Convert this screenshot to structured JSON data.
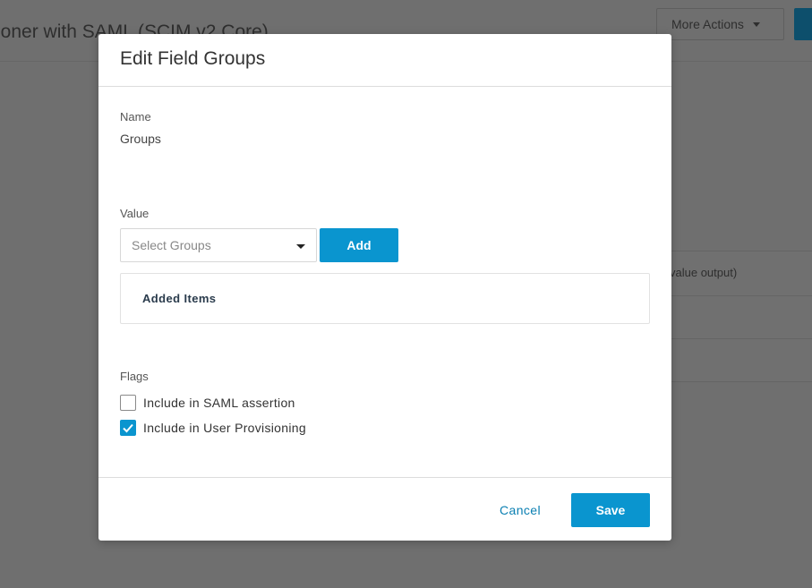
{
  "background": {
    "page_title": "ioner with SAML (SCIM v2 Core)",
    "more_actions_label": "More Actions",
    "table_text": "value output)"
  },
  "modal": {
    "title": "Edit Field Groups",
    "name_label": "Name",
    "name_value": "Groups",
    "value_label": "Value",
    "select_placeholder": "Select Groups",
    "add_label": "Add",
    "added_items_label": "Added Items",
    "flags_label": "Flags",
    "flags": [
      {
        "label": "Include in SAML assertion",
        "checked": false
      },
      {
        "label": "Include in User Provisioning",
        "checked": true
      }
    ],
    "cancel_label": "Cancel",
    "save_label": "Save"
  },
  "colors": {
    "accent": "#0a95cf",
    "link": "#0a7fb2",
    "overlay": "#6f6f6f"
  }
}
